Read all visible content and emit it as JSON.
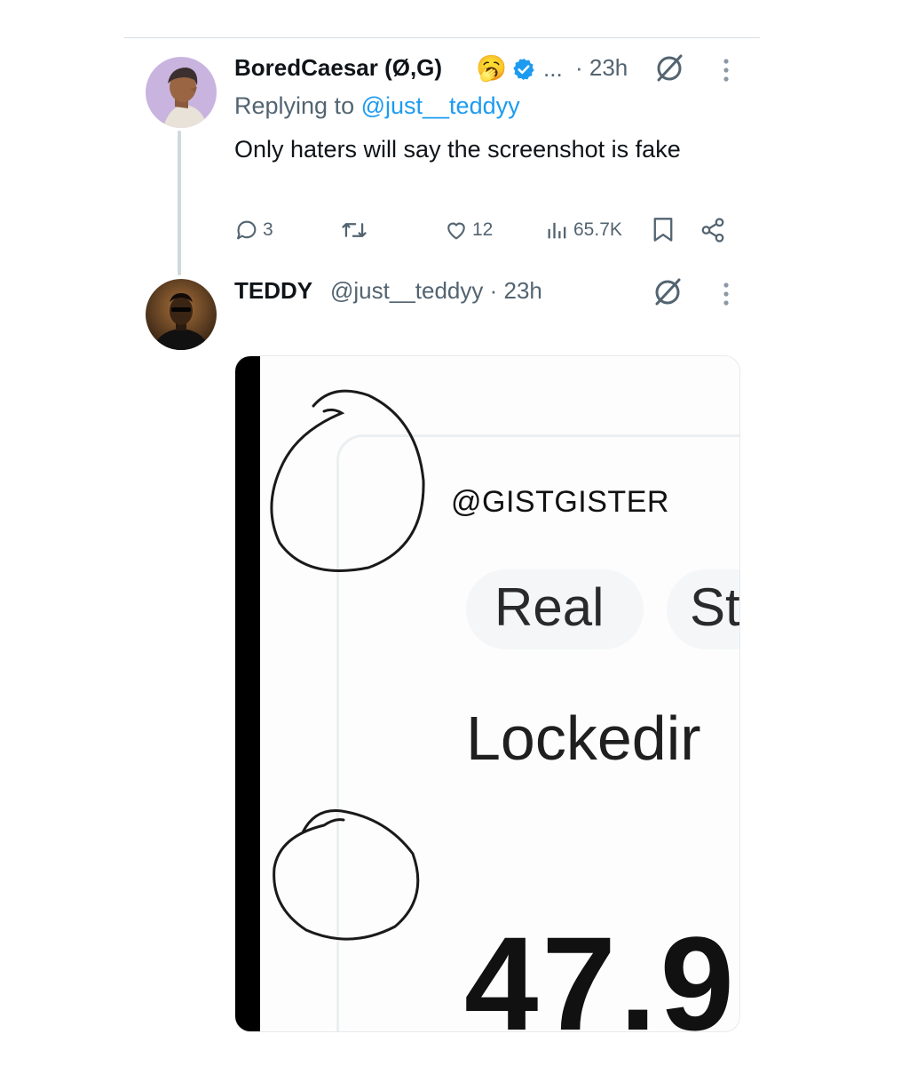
{
  "reply_tweet": {
    "name": "BoredCaesar (Ø,G)",
    "emoji": "🥱",
    "ellipsis": "...",
    "time": "· 23h",
    "replying_prefix": "Replying to ",
    "replying_handle": "@just__teddyy",
    "text": "Only haters will say the screenshot is fake",
    "replies": "3",
    "likes": "12",
    "views": "65.7K"
  },
  "main_tweet": {
    "name": "TEDDY",
    "handle_time": "@just__teddyy · 23h"
  },
  "media": {
    "watermark": "@GISTGISTER",
    "chip_1": "Real",
    "chip_2": "St",
    "locked_text": "Lockedir",
    "big_number": "47.9"
  },
  "colors": {
    "accent": "#1d9bf0",
    "muted": "#536471",
    "text": "#0f1419"
  }
}
